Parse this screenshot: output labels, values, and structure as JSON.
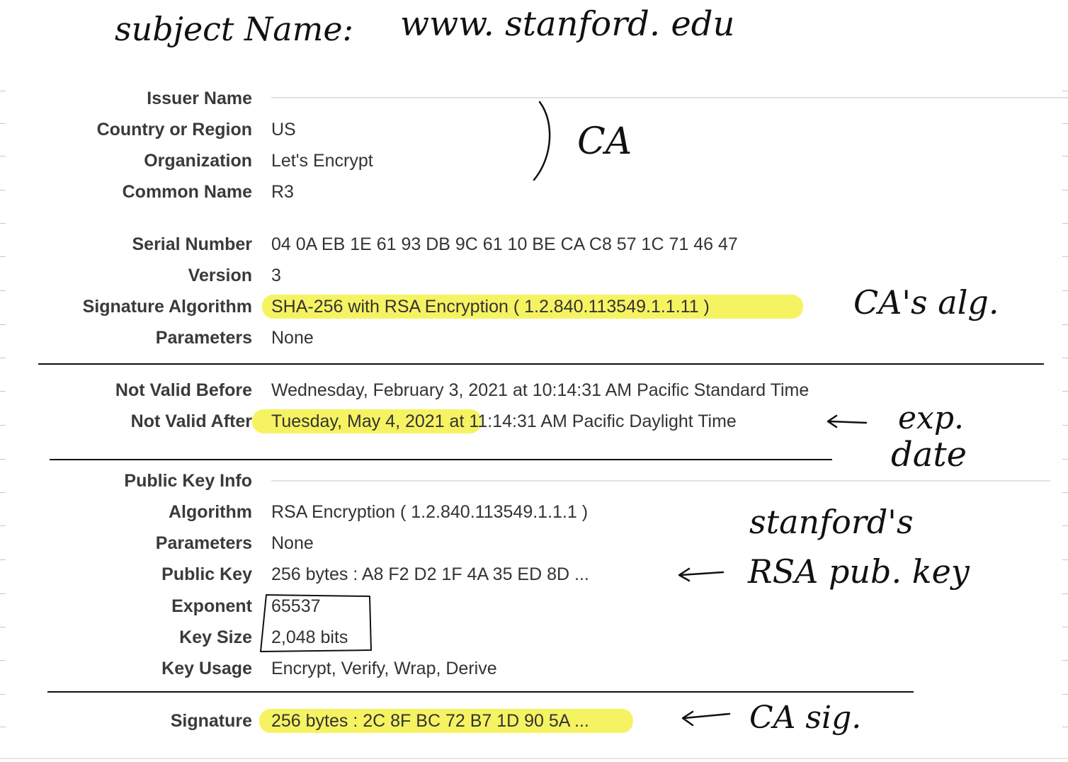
{
  "handwriting": {
    "subject": "subject Name:",
    "subject_value": "www. stanford. edu",
    "ca": "CA",
    "ca_alg": "CA's alg.",
    "exp_1": "exp.",
    "exp_2": "date",
    "stanford_1": "stanford's",
    "stanford_2": "RSA pub. key",
    "ca_sig": "CA sig."
  },
  "certificate": {
    "issuer": {
      "heading": "Issuer Name",
      "country_label": "Country or Region",
      "country": "US",
      "org_label": "Organization",
      "org": "Let's Encrypt",
      "cn_label": "Common Name",
      "cn": "R3"
    },
    "serial_label": "Serial Number",
    "serial": "04 0A EB 1E 61 93 DB 9C 61 10 BE CA C8 57 1C 71 46 47",
    "version_label": "Version",
    "version": "3",
    "sigalg_label": "Signature Algorithm",
    "sigalg": "SHA-256 with RSA Encryption ( 1.2.840.113549.1.1.11 )",
    "params_label": "Parameters",
    "params": "None",
    "nvb_label": "Not Valid Before",
    "nvb": "Wednesday, February 3, 2021 at 10:14:31 AM Pacific Standard Time",
    "nva_label": "Not Valid After",
    "nva_date": "Tuesday, May 4, 2021",
    "nva_rest": " at 11:14:31 AM Pacific Daylight Time",
    "pubkey": {
      "heading": "Public Key Info",
      "alg_label": "Algorithm",
      "alg": "RSA Encryption ( 1.2.840.113549.1.1.1 )",
      "params_label": "Parameters",
      "params": "None",
      "key_label": "Public Key",
      "key": "256 bytes : A8 F2 D2 1F 4A 35 ED 8D ...",
      "exp_label": "Exponent",
      "exp": "65537",
      "size_label": "Key Size",
      "size": "2,048 bits",
      "usage_label": "Key Usage",
      "usage": "Encrypt, Verify, Wrap, Derive"
    },
    "signature_label": "Signature",
    "signature": "256 bytes : 2C 8F BC 72 B7 1D 90 5A ..."
  },
  "colors": {
    "highlight": "#f6f25a",
    "label": "#3a3a3a",
    "ink": "#111111"
  }
}
